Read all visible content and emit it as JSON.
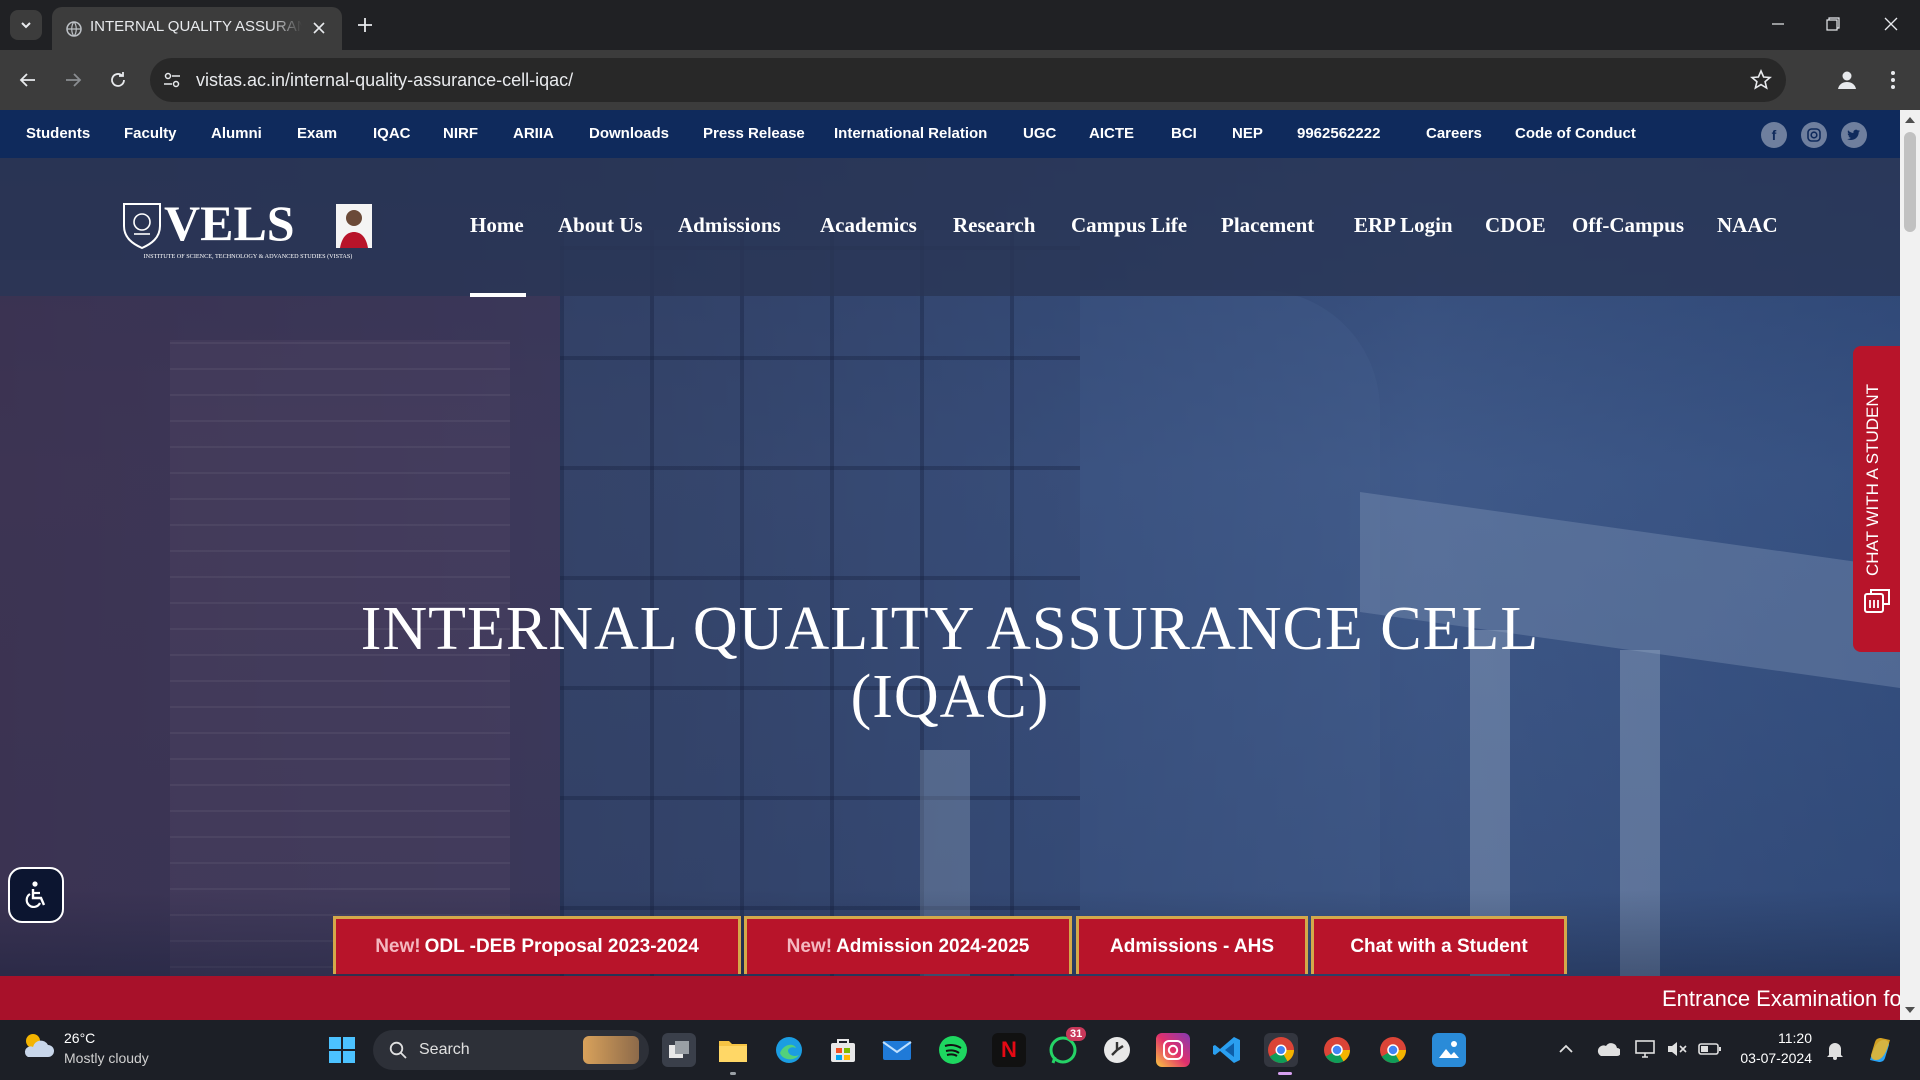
{
  "browser": {
    "tab_title": "INTERNAL QUALITY ASSURANCE CELL (IQAC)",
    "url": "vistas.ac.in/internal-quality-assurance-cell-iqac/"
  },
  "topbar": {
    "links": [
      "Students",
      "Faculty",
      "Alumni",
      "Exam",
      "IQAC",
      "NIRF",
      "ARIIA",
      "Downloads",
      "Press Release",
      "International Relation",
      "UGC",
      "AICTE",
      "BCI",
      "NEP",
      "9962562222",
      "Careers",
      "Code of Conduct"
    ],
    "social": [
      "facebook-icon",
      "instagram-icon",
      "twitter-icon"
    ]
  },
  "logo": {
    "name": "VELS",
    "tagline": "INSTITUTE OF SCIENCE, TECHNOLOGY & ADVANCED STUDIES (VISTAS)"
  },
  "nav": {
    "items": [
      "Home",
      "About Us",
      "Admissions",
      "Academics",
      "Research",
      "Campus Life",
      "Placement",
      "ERP Login",
      "CDOE",
      "Off-Campus",
      "NAAC"
    ],
    "active": "Home"
  },
  "hero": {
    "title_line1": "INTERNAL QUALITY ASSURANCE CELL",
    "title_line2": "(IQAC)"
  },
  "side_chat": {
    "label": "CHAT WITH A STUDENT"
  },
  "cta_buttons": [
    {
      "badge": "New!",
      "label": "ODL -DEB Proposal 2023-2024"
    },
    {
      "badge": "New!",
      "label": "Admission 2024-2025"
    },
    {
      "badge": "",
      "label": "Admissions - AHS"
    },
    {
      "badge": "",
      "label": "Chat with a Student"
    }
  ],
  "ticker": {
    "text": "Entrance Examination fo"
  },
  "taskbar": {
    "weather_temp": "26°C",
    "weather_cond": "Mostly cloudy",
    "search_label": "Search",
    "whatsapp_badge": "31",
    "time": "11:20",
    "date": "03-07-2024"
  },
  "colors": {
    "topbar_bg": "#0f2a5c",
    "accent_red": "#b8142a",
    "gold_border": "#d4a94a"
  }
}
